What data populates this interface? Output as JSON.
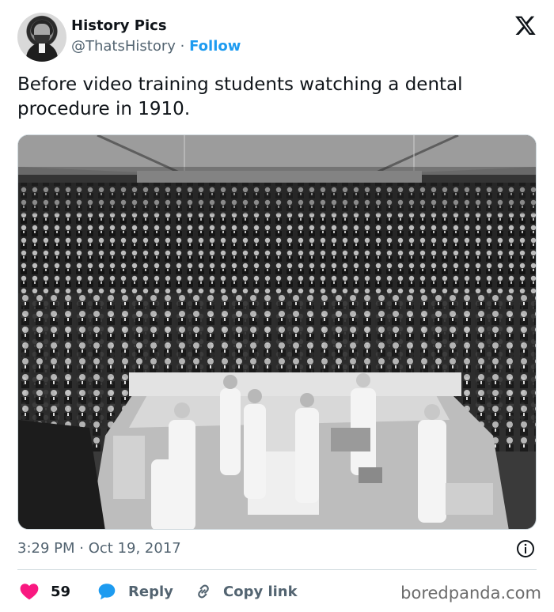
{
  "author": {
    "name": "History Pics",
    "handle": "@ThatsHistory",
    "separator": "·",
    "follow_label": "Follow",
    "avatar_icon": "avatar-portrait"
  },
  "platform_logo": "x-logo",
  "tweet": {
    "text": "Before video training students watching a dental procedure in 1910.",
    "image_icon": "photo-operating-theatre"
  },
  "meta": {
    "time": "3:29 PM",
    "separator": "·",
    "date": "Oct 19, 2017",
    "info_icon": "info-icon"
  },
  "actions": {
    "like_count": "59",
    "reply_label": "Reply",
    "copy_label": "Copy link"
  },
  "watermark": "boredpanda.com",
  "colors": {
    "accent": "#1d9bf0",
    "like": "#f91880",
    "text": "#0f1419",
    "secondary": "#536471"
  }
}
